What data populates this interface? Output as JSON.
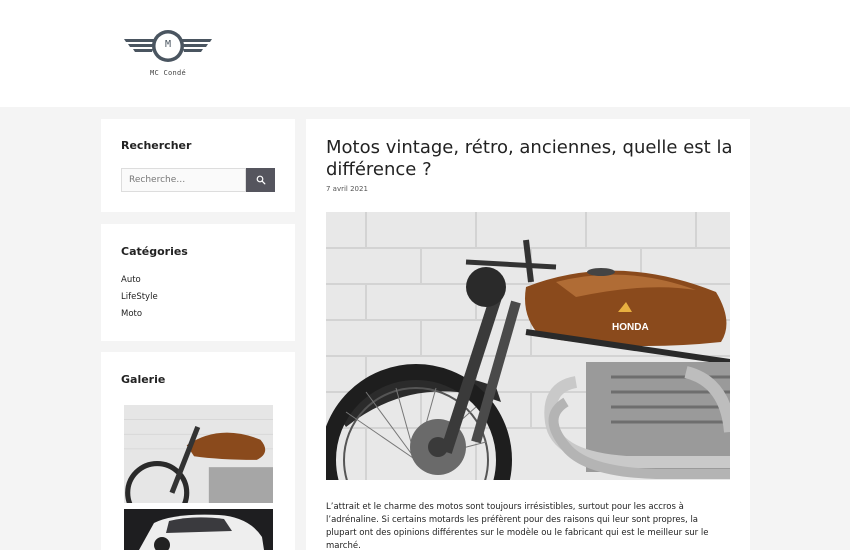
{
  "header": {
    "logo_letter": "M",
    "logo_text": "MC Condé"
  },
  "sidebar": {
    "search": {
      "title": "Rechercher",
      "placeholder": "Recherche…",
      "button_icon": "search-icon"
    },
    "categories": {
      "title": "Catégories",
      "items": [
        "Auto",
        "LifeStyle",
        "Moto"
      ]
    },
    "gallery": {
      "title": "Galerie"
    }
  },
  "article": {
    "title": "Motos vintage, rétro, anciennes, quelle est la différence ?",
    "date": "7 avril 2021",
    "image_brand": "HONDA",
    "excerpt": "L’attrait et le charme des motos sont toujours irrésistibles, surtout pour les accros à l’adrénaline. Si certains motards les préfèrent pour des raisons qui leur sont propres, la plupart ont des opinions différentes sur le modèle ou le fabricant qui est le meilleur sur le marché."
  },
  "colors": {
    "page_bg": "#f4f4f4",
    "card_bg": "#ffffff",
    "search_button": "#55555e",
    "tank": "#8a4a1c"
  }
}
